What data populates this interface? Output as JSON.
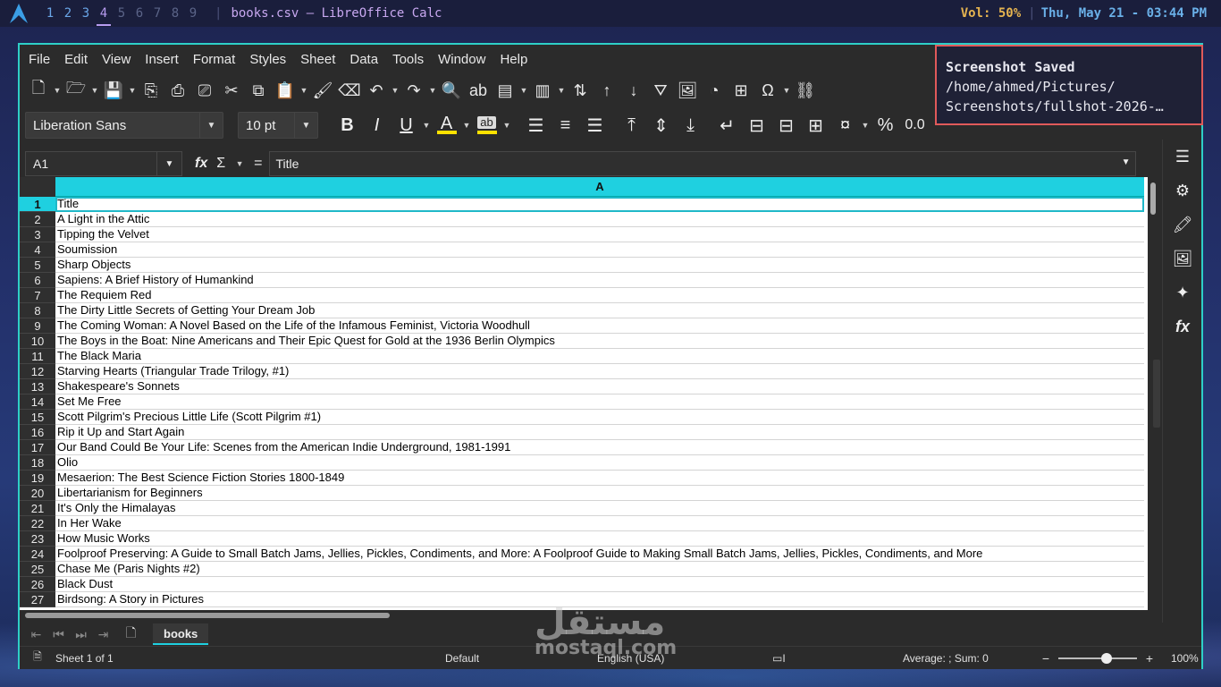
{
  "topbar": {
    "workspaces": [
      "1",
      "2",
      "3",
      "4",
      "5",
      "6",
      "7",
      "8",
      "9"
    ],
    "window_title": "books.csv — LibreOffice Calc",
    "volume": "Vol: 50%",
    "clock": "Thu, May 21 - 03:44 PM"
  },
  "menubar": [
    "File",
    "Edit",
    "View",
    "Insert",
    "Format",
    "Styles",
    "Sheet",
    "Data",
    "Tools",
    "Window",
    "Help"
  ],
  "format": {
    "font_name": "Liberation Sans",
    "font_size": "10 pt"
  },
  "formula": {
    "cell_ref": "A1",
    "content": "Title"
  },
  "sheet": {
    "column_header": "A",
    "rows": [
      {
        "num": "1",
        "value": "Title"
      },
      {
        "num": "2",
        "value": "A Light in the Attic"
      },
      {
        "num": "3",
        "value": "Tipping the Velvet"
      },
      {
        "num": "4",
        "value": "Soumission"
      },
      {
        "num": "5",
        "value": "Sharp Objects"
      },
      {
        "num": "6",
        "value": "Sapiens: A Brief History of Humankind"
      },
      {
        "num": "7",
        "value": "The Requiem Red"
      },
      {
        "num": "8",
        "value": "The Dirty Little Secrets of Getting Your Dream Job"
      },
      {
        "num": "9",
        "value": "The Coming Woman: A Novel Based on the Life of the Infamous Feminist, Victoria Woodhull"
      },
      {
        "num": "10",
        "value": "The Boys in the Boat: Nine Americans and Their Epic Quest for Gold at the 1936 Berlin Olympics"
      },
      {
        "num": "11",
        "value": "The Black Maria"
      },
      {
        "num": "12",
        "value": "Starving Hearts (Triangular Trade Trilogy, #1)"
      },
      {
        "num": "13",
        "value": "Shakespeare's Sonnets"
      },
      {
        "num": "14",
        "value": "Set Me Free"
      },
      {
        "num": "15",
        "value": "Scott Pilgrim's Precious Little Life (Scott Pilgrim #1)"
      },
      {
        "num": "16",
        "value": "Rip it Up and Start Again"
      },
      {
        "num": "17",
        "value": "Our Band Could Be Your Life: Scenes from the American Indie Underground, 1981-1991"
      },
      {
        "num": "18",
        "value": "Olio"
      },
      {
        "num": "19",
        "value": "Mesaerion: The Best Science Fiction Stories 1800-1849"
      },
      {
        "num": "20",
        "value": "Libertarianism for Beginners"
      },
      {
        "num": "21",
        "value": "It's Only the Himalayas"
      },
      {
        "num": "22",
        "value": "In Her Wake"
      },
      {
        "num": "23",
        "value": "How Music Works"
      },
      {
        "num": "24",
        "value": "Foolproof Preserving: A Guide to Small Batch Jams, Jellies, Pickles, Condiments, and More: A Foolproof Guide to Making Small Batch Jams, Jellies, Pickles, Condiments, and More"
      },
      {
        "num": "25",
        "value": "Chase Me (Paris Nights #2)"
      },
      {
        "num": "26",
        "value": "Black Dust"
      },
      {
        "num": "27",
        "value": "Birdsong: A Story in Pictures"
      }
    ],
    "tab_name": "books"
  },
  "statusbar": {
    "sheet_info": "Sheet 1 of 1",
    "page_style": "Default",
    "language": "English (USA)",
    "summary": "Average: ; Sum: 0",
    "zoom": "100%"
  },
  "notification": {
    "title": "Screenshot Saved",
    "body": "/home/ahmed/Pictures/\nScreenshots/fullshot-2026-…"
  },
  "watermark": {
    "arabic": "مستقل",
    "latin": "mostaql.com"
  },
  "colors": {
    "accent": "#1fd0e0",
    "window_border": "#2ecfc7",
    "notification_border": "#e05a5a"
  }
}
